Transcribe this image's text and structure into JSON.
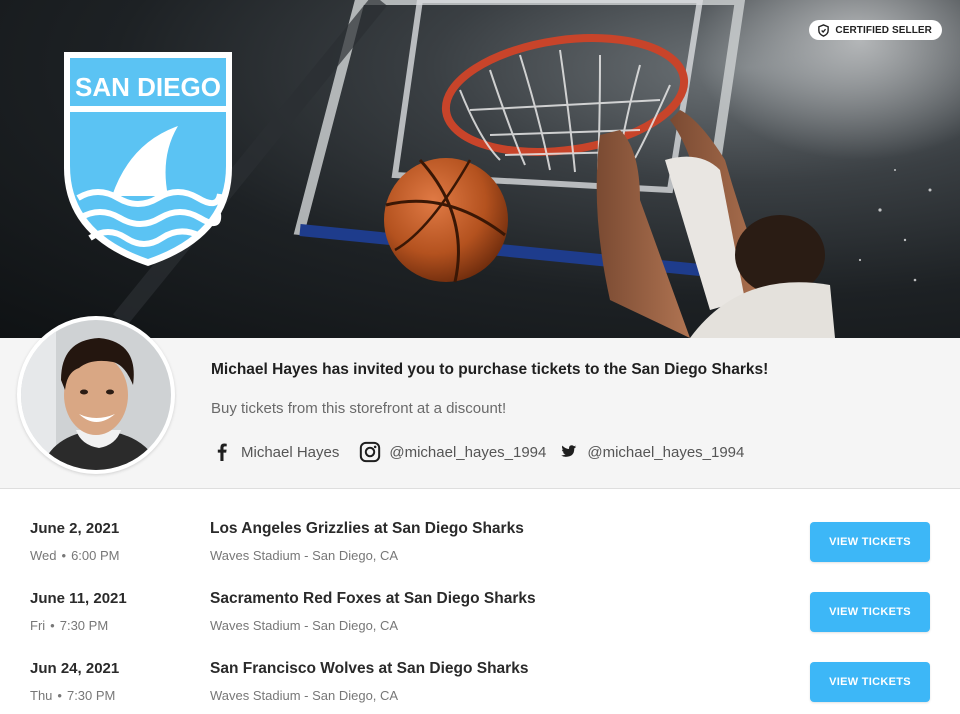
{
  "header": {
    "badge_label": "CERTIFIED SELLER",
    "team_logo_text": "SAN DIEGO",
    "logo_color": "#5bc3f3"
  },
  "profile": {
    "title": "Michael Hayes has invited you to purchase tickets to the San Diego Sharks!",
    "subtitle": "Buy tickets from this storefront at a discount!",
    "socials": {
      "facebook": {
        "icon": "facebook-icon",
        "label": "Michael Hayes"
      },
      "instagram": {
        "icon": "instagram-icon",
        "label": "@michael_hayes_1994"
      },
      "twitter": {
        "icon": "twitter-icon",
        "label": "@michael_hayes_1994"
      }
    }
  },
  "events": [
    {
      "date": "June 2, 2021",
      "day": "Wed",
      "time": "6:00 PM",
      "name": "Los Angeles Grizzlies at San Diego Sharks",
      "venue": "Waves Stadium - San Diego, CA",
      "button_label": "VIEW TICKETS"
    },
    {
      "date": "June 11, 2021",
      "day": "Fri",
      "time": "7:30 PM",
      "name": "Sacramento Red Foxes at San Diego Sharks",
      "venue": "Waves Stadium - San Diego, CA",
      "button_label": "VIEW TICKETS"
    },
    {
      "date": "Jun 24, 2021",
      "day": "Thu",
      "time": "7:30 PM",
      "name": "San Francisco Wolves at San Diego Sharks",
      "venue": "Waves Stadium - San Diego, CA",
      "button_label": "VIEW TICKETS"
    }
  ],
  "colors": {
    "accent": "#3db7f7",
    "profile_background": "#f5f5f5"
  }
}
